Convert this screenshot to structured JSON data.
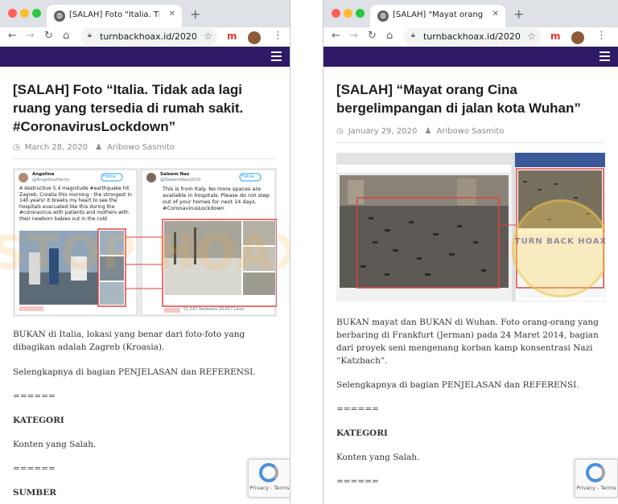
{
  "left": {
    "tab_title": "[SALAH] Foto \"Italia. Tidak ada",
    "url": "turnbackhoax.id/2020/...",
    "title": "[SALAH] Foto “Italia. Tidak ada lagi ruang yang tersedia di rumah sakit. #CoronavirusLockdown”",
    "date": "March 28, 2020",
    "author": "Aribowo Sasmito",
    "tweet_left": {
      "name": "Angelina",
      "handle": "@AngelinaHarrin",
      "follow": "Follow",
      "text": "A destructive 5.4 magnitude #earthquake hit Zagreb, Croatia this morning - the strongest in 140 years! It breaks my heart to see the hospitals evacuated like this during the #coronavirus with patients and mothers with their newborn babies out in the cold"
    },
    "tweet_right": {
      "name": "Saleem Naz",
      "handle": "@SaleemNaz2020",
      "follow": "Follow",
      "text": "This is from Italy. No more spaces are available in hospitals.  Please do not step out of your homes for next 14 days. #CoronavirusLockdown",
      "retweets": "51,547 Retweets",
      "likes": "26,627 Likes"
    },
    "paragraphs": [
      "BUKAN di Italia, lokasi yang benar dari foto-foto yang dibagikan adalah Zagreb (Kroasia).",
      "Selengkapnya di bagian PENJELASAN dan REFERENSI.",
      "======",
      "KATEGORI",
      "Konten yang Salah.",
      "======",
      "SUMBER"
    ]
  },
  "right": {
    "tab_title": "[SALAH] \"Mayat orang Cina be",
    "url": "turnbackhoax.id/2020/...",
    "title": "[SALAH] “Mayat orang Cina bergelimpangan di jalan kota Wuhan”",
    "date": "January 29, 2020",
    "author": "Aribowo Sasmito",
    "paragraphs": [
      "BUKAN mayat dan BUKAN di Wuhan. Foto orang-orang yang berbaring di Frankfurt (Jerman) pada 24 Maret 2014, bagian dari proyek seni mengenang korban kamp konsentrasi Nazi “Katzbach”.",
      "Selengkapnya di bagian PENJELASAN dan REFERENSI.",
      "======",
      "KATEGORI",
      "Konten yang Salah.",
      "======"
    ],
    "seal_text": "TURN BACK HOAX"
  },
  "recaptcha": "Privacy - Terms",
  "watermark": "STOP HOAX",
  "colors": {
    "navbar": "#2e1a66",
    "highlight_box": "#e0433b"
  }
}
